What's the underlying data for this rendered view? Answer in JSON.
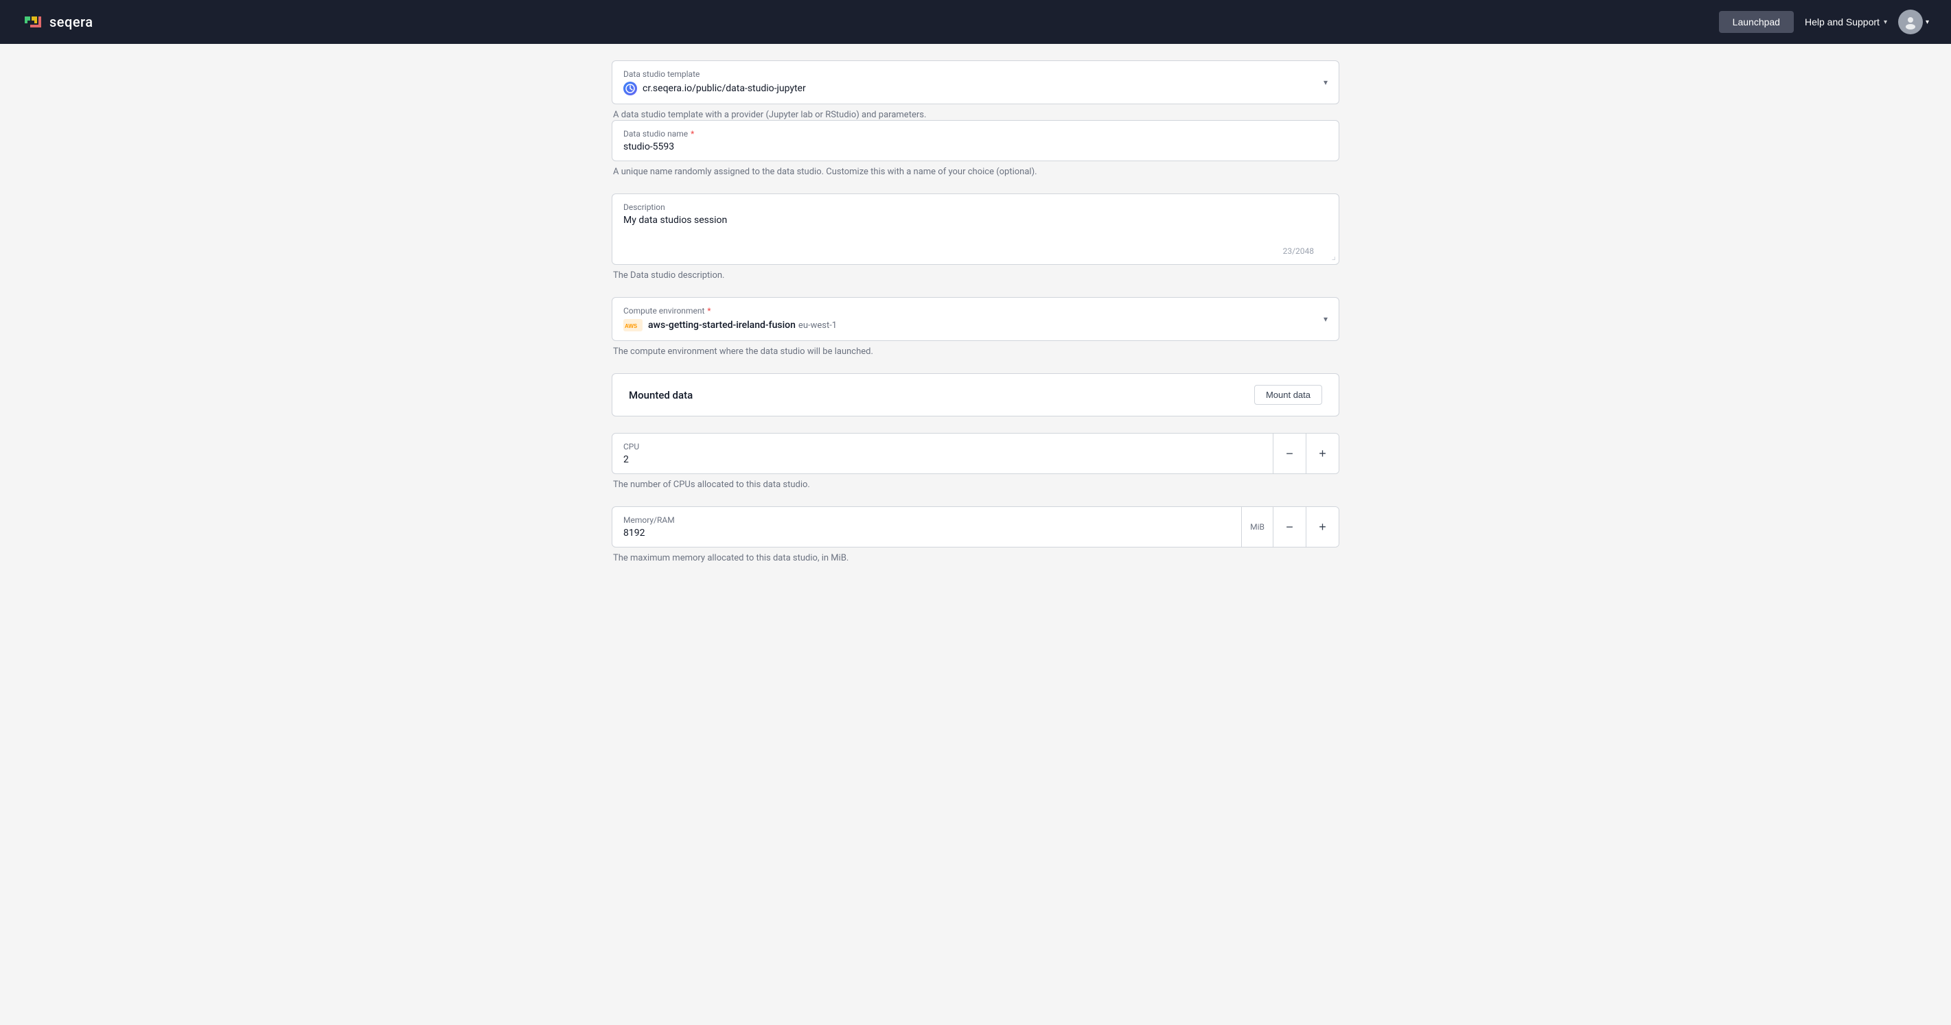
{
  "navbar": {
    "logo_text": "seqera",
    "launchpad_label": "Launchpad",
    "help_support_label": "Help and Support",
    "user_avatar_alt": "User avatar"
  },
  "form": {
    "template_section": {
      "label": "Data studio template",
      "value": "cr.seqera.io/public/data-studio-jupyter",
      "hint": "A data studio template with a provider (Jupyter lab or RStudio) and parameters."
    },
    "name_section": {
      "label": "Data studio name",
      "required": true,
      "value": "studio-5593",
      "hint": "A unique name randomly assigned to the data studio. Customize this with a name of your choice (optional)."
    },
    "description_section": {
      "label": "Description",
      "value": "My data studios session",
      "char_count": "23/2048",
      "hint": "The Data studio description."
    },
    "compute_env_section": {
      "label": "Compute environment",
      "required": true,
      "env_name": "aws-getting-started-ireland-fusion",
      "region": "eu-west-1",
      "hint": "The compute environment where the data studio will be launched."
    },
    "mounted_data_section": {
      "label": "Mounted data",
      "button_label": "Mount data"
    },
    "cpu_section": {
      "label": "CPU",
      "value": "2",
      "hint": "The number of CPUs allocated to this data studio."
    },
    "memory_section": {
      "label": "Memory/RAM",
      "value": "8192",
      "unit": "MiB",
      "hint": "The maximum memory allocated to this data studio, in MiB."
    }
  },
  "icons": {
    "dropdown_arrow": "▾",
    "minus": "−",
    "plus": "+"
  }
}
